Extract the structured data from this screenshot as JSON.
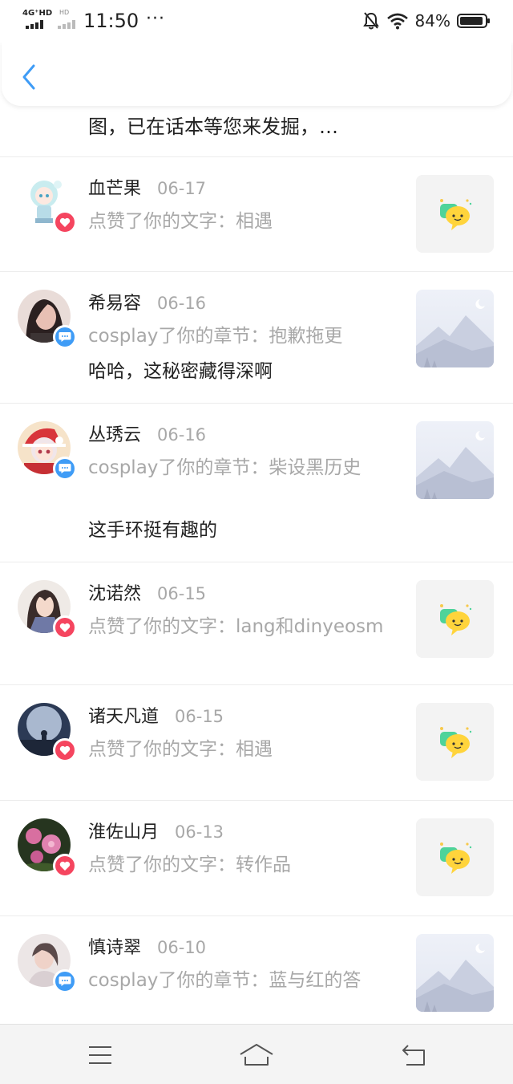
{
  "status_bar": {
    "network_1": "4G⁺HD",
    "network_2": "HD",
    "time": "11:50",
    "dots": "···",
    "battery_percent": "84%"
  },
  "clipped_item": {
    "text": "图，已在话本等您来发掘，…"
  },
  "notifications": [
    {
      "name": "血芒果",
      "date": "06-17",
      "action": "点赞了你的文字：相遇",
      "reply": "",
      "badge": "like",
      "thumb": "chat"
    },
    {
      "name": "希易容",
      "date": "06-16",
      "action": "cosplay了你的章节：抱歉拖更",
      "reply": "哈哈，这秘密藏得深啊",
      "badge": "comment",
      "thumb": "mountain"
    },
    {
      "name": "丛琇云",
      "date": "06-16",
      "action": "cosplay了你的章节：柴设黑历史",
      "reply": "这手环挺有趣的",
      "badge": "comment",
      "thumb": "mountain"
    },
    {
      "name": "沈诺然",
      "date": "06-15",
      "action": "点赞了你的文字：lang和dinyeosm",
      "reply": "",
      "badge": "like",
      "thumb": "chat"
    },
    {
      "name": "诸天凡道",
      "date": "06-15",
      "action": "点赞了你的文字：相遇",
      "reply": "",
      "badge": "like",
      "thumb": "chat"
    },
    {
      "name": "淮佐山月",
      "date": "06-13",
      "action": "点赞了你的文字：转作品",
      "reply": "",
      "badge": "like",
      "thumb": "chat"
    },
    {
      "name": "慎诗翠",
      "date": "06-10",
      "action": "cosplay了你的章节：蓝与红的答",
      "reply": "",
      "badge": "comment",
      "thumb": "mountain"
    }
  ],
  "icons": {
    "back": "chevron-left-icon",
    "like_badge": "heart-icon",
    "comment_badge": "chat-bubble-icon",
    "nav_menu": "menu-icon",
    "nav_home": "home-icon",
    "nav_back": "return-icon"
  },
  "colors": {
    "accent_blue": "#3f9cf6",
    "like_red": "#f5455f",
    "secondary_text": "#a8a8a8"
  }
}
